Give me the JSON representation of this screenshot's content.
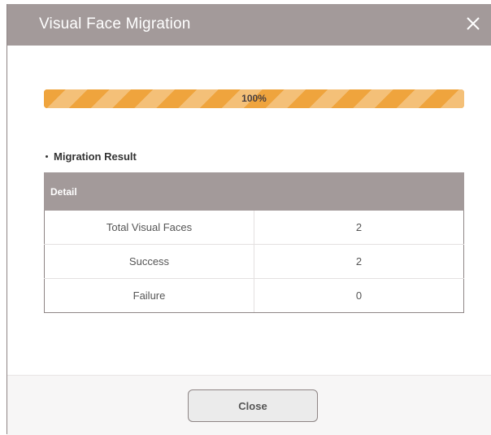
{
  "dialog": {
    "title": "Visual Face Migration",
    "close_icon": "close-icon"
  },
  "progress": {
    "percent": 100,
    "label": "100%",
    "fill_color": "#efa43d"
  },
  "section": {
    "title": "Migration Result"
  },
  "table": {
    "header": "Detail",
    "rows": [
      {
        "label": "Total Visual Faces",
        "value": "2"
      },
      {
        "label": "Success",
        "value": "2"
      },
      {
        "label": "Failure",
        "value": "0"
      }
    ]
  },
  "footer": {
    "close_label": "Close"
  },
  "colors": {
    "titlebar": "#a39a9a",
    "accent": "#efa43d"
  }
}
